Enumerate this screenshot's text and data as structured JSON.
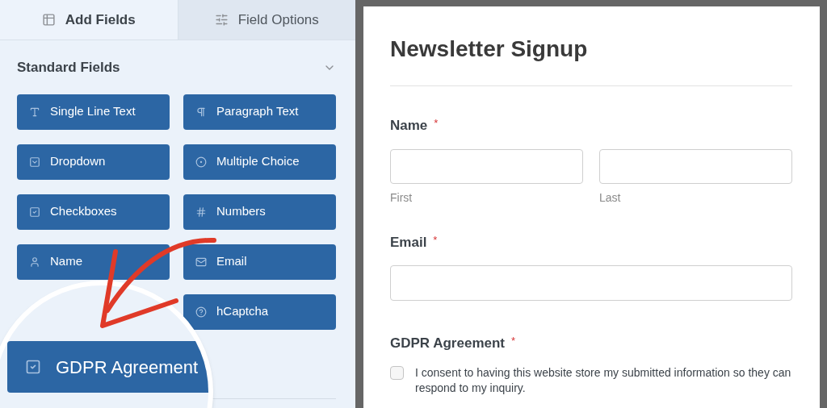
{
  "tabs": [
    {
      "label": "Add Fields",
      "kind": "fields",
      "selected": true
    },
    {
      "label": "Field Options",
      "kind": "options",
      "selected": false
    }
  ],
  "section": {
    "title": "Standard Fields",
    "expanded": true
  },
  "field_buttons": [
    {
      "label": "Single Line Text",
      "kind": "text"
    },
    {
      "label": "Paragraph Text",
      "kind": "paragraph"
    },
    {
      "label": "Dropdown",
      "kind": "dropdown"
    },
    {
      "label": "Multiple Choice",
      "kind": "radio"
    },
    {
      "label": "Checkboxes",
      "kind": "checkbox"
    },
    {
      "label": "Numbers",
      "kind": "number"
    },
    {
      "label": "Name",
      "kind": "name"
    },
    {
      "label": "Email",
      "kind": "email"
    },
    {
      "kind": "covered"
    },
    {
      "label": "hCaptcha",
      "kind": "captcha"
    }
  ],
  "magnified_button": {
    "label": "GDPR Agreement",
    "kind": "checkbox"
  },
  "form": {
    "title": "Newsletter Signup",
    "fields": [
      {
        "kind": "name",
        "label": "Name",
        "required": "*",
        "sublabels": [
          "First",
          "Last"
        ]
      },
      {
        "kind": "email",
        "label": "Email",
        "required": "*"
      },
      {
        "kind": "gdpr",
        "label": "GDPR Agreement",
        "required": "*",
        "checked": false,
        "text": "I consent to having this website store my submitted information so they can respond to my inquiry."
      }
    ]
  }
}
